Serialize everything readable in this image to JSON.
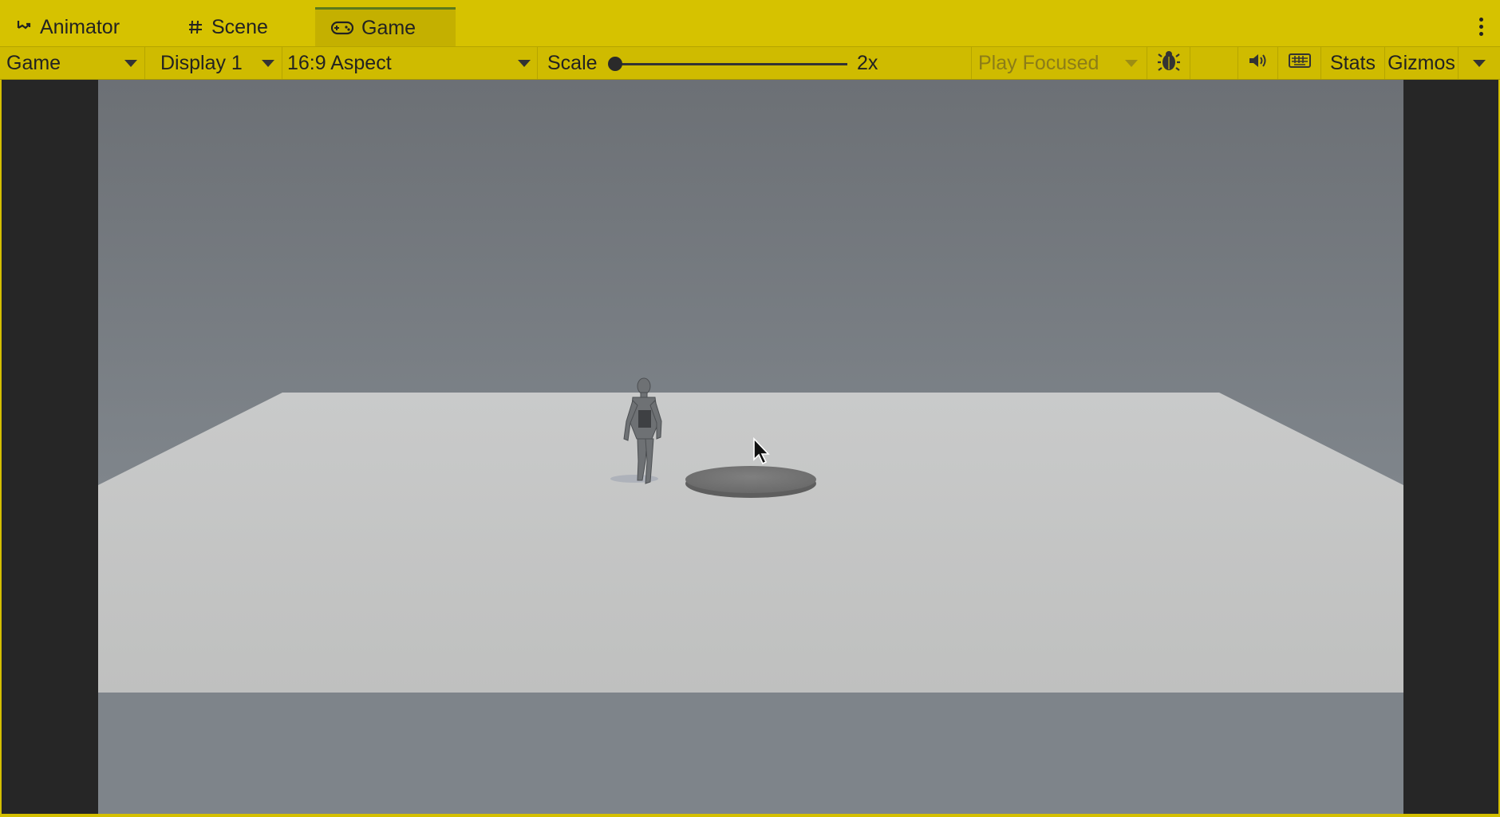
{
  "tabs": [
    {
      "label": "Animator",
      "icon": "animator-icon"
    },
    {
      "label": "Scene",
      "icon": "scene-grid-icon"
    },
    {
      "label": "Game",
      "icon": "gamepad-icon",
      "active": true
    }
  ],
  "toolbar": {
    "view_mode": "Game",
    "display": "Display 1",
    "aspect": "16:9 Aspect",
    "scale_label": "Scale",
    "scale_value": "2x",
    "scale_fraction": 0.0,
    "play_mode": "Play Focused",
    "stats_label": "Stats",
    "gizmos_label": "Gizmos",
    "icons": [
      "bug-icon",
      "speaker-icon",
      "keyboard-icon"
    ]
  },
  "scene": {
    "sky_color": "#7a7f85",
    "floor_color": "#c2c3c2",
    "platform_color": "#7a7a7a",
    "objects": [
      "humanoid-character",
      "circular-platform",
      "floor-plane"
    ]
  },
  "colors": {
    "highlight_bar": "#d4bf00",
    "game_letterbox": "#262626"
  }
}
